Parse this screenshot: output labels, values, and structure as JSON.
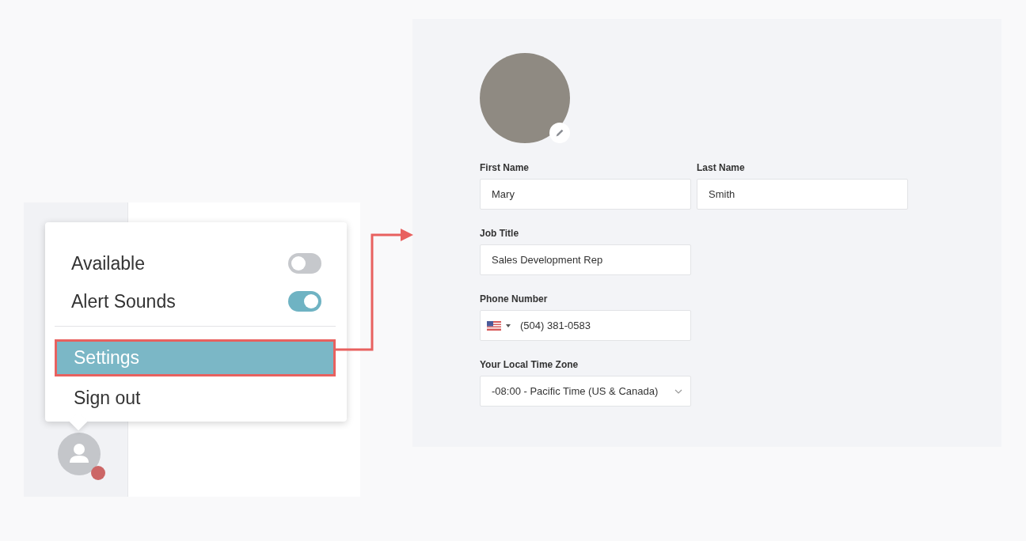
{
  "menu": {
    "toggles": [
      {
        "label": "Available",
        "on": false
      },
      {
        "label": "Alert Sounds",
        "on": true
      }
    ],
    "items": [
      {
        "label": "Settings",
        "selected": true
      },
      {
        "label": "Sign out",
        "selected": false
      }
    ]
  },
  "profile": {
    "fields": [
      {
        "kind": "text",
        "label": "First Name",
        "value": "Mary"
      },
      {
        "kind": "text",
        "label": "Last Name",
        "value": "Smith"
      },
      {
        "kind": "text",
        "label": "Job Title",
        "value": "Sales Development Rep"
      },
      {
        "kind": "phone",
        "label": "Phone Number",
        "value": "(504) 381-0583"
      },
      {
        "kind": "select",
        "label": "Your Local Time Zone",
        "value": "-08:00 - Pacific Time (US & Canada)"
      }
    ]
  }
}
